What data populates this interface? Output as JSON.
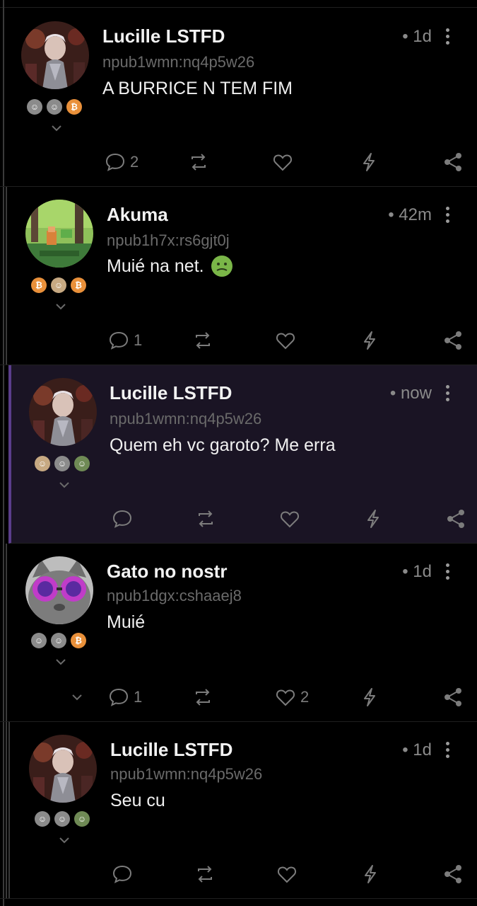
{
  "notes": [
    {
      "author": "Lucille LSTFD",
      "handle": "npub1wmn:nq4p5w26",
      "time": "• 1d",
      "content": "A BURRICE N TEM FIM",
      "replies": "2",
      "likes": "",
      "avatar": "anime-warrior-avatar",
      "badges": [
        "grey",
        "grey",
        "btc"
      ]
    },
    {
      "author": "Akuma",
      "handle": "npub1h7x:rs6gjt0j",
      "time": "• 42m",
      "content": "Muié na net.",
      "emoji": "nauseated-face-emoji",
      "replies": "1",
      "likes": "",
      "avatar": "pixel-landscape-avatar",
      "badges": [
        "btc",
        "tan",
        "btc"
      ]
    },
    {
      "author": "Lucille LSTFD",
      "handle": "npub1wmn:nq4p5w26",
      "time": "• now",
      "content": "Quem eh vc garoto? Me erra",
      "replies": "",
      "likes": "",
      "avatar": "anime-warrior-avatar",
      "badges": [
        "tan",
        "grey",
        "green"
      ]
    },
    {
      "author": "Gato no nostr",
      "handle": "npub1dgx:cshaaej8",
      "time": "• 1d",
      "content": "Muié",
      "replies": "1",
      "likes": "2",
      "avatar": "cat-with-glasses-avatar",
      "badges": [
        "grey",
        "grey",
        "btc"
      ]
    },
    {
      "author": "Lucille LSTFD",
      "handle": "npub1wmn:nq4p5w26",
      "time": "• 1d",
      "content": "Seu cu",
      "replies": "",
      "likes": "",
      "avatar": "anime-warrior-avatar",
      "badges": [
        "grey",
        "grey",
        "green"
      ]
    }
  ],
  "icons": {
    "reply": "speech-bubble-icon",
    "repost": "repost-icon",
    "like": "heart-icon",
    "zap": "lightning-icon",
    "share": "share-icon",
    "menu": "more-vertical-icon",
    "expand": "chevron-down-icon"
  },
  "colors": {
    "background": "#000000",
    "highlight": "#1a1424",
    "accent": "#5a3d8a",
    "btc": "#e9903a"
  }
}
